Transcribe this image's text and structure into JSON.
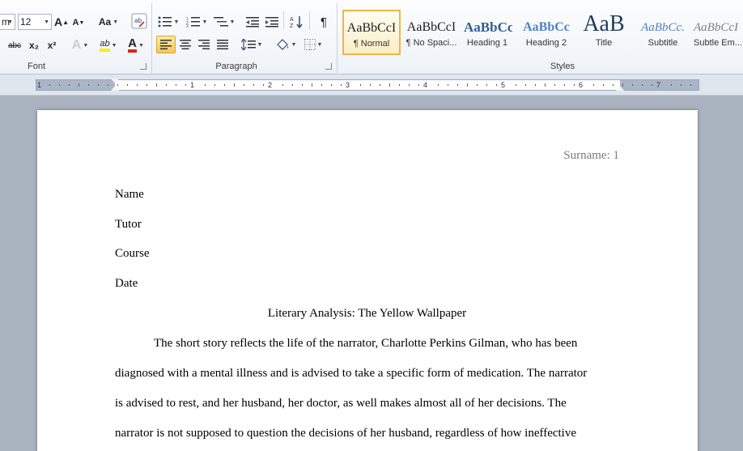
{
  "ribbon": {
    "font": {
      "font_name_fragment": "m",
      "font_size": "12",
      "group_label": "Font",
      "grow_font_icon": "A",
      "shrink_font_icon": "A",
      "change_case_label": "Aa",
      "clear_format_icon": "abc",
      "strikethrough_label": "abc",
      "subscript_label": "x₂",
      "superscript_label": "x²",
      "text_effects_label": "A",
      "highlight_label": "ab",
      "font_color_label": "A"
    },
    "paragraph": {
      "group_label": "Paragraph",
      "pilcrow": "¶"
    },
    "styles": {
      "group_label": "Styles",
      "items": [
        {
          "preview": "AaBbCcI",
          "name": "¶ Normal"
        },
        {
          "preview": "AaBbCcI",
          "name": "¶ No Spaci..."
        },
        {
          "preview": "AaBbCc",
          "name": "Heading 1"
        },
        {
          "preview": "AaBbCc",
          "name": "Heading 2"
        },
        {
          "preview": "AaB",
          "name": "Title"
        },
        {
          "preview": "AaBbCc.",
          "name": "Subtitle"
        },
        {
          "preview": "AaBbCcI",
          "name": "Subtle Em..."
        }
      ]
    }
  },
  "ruler": {
    "labels": [
      "1",
      "1",
      "2",
      "3",
      "4",
      "5",
      "6",
      "7"
    ]
  },
  "document": {
    "header": "Surname: 1",
    "name": "Name",
    "tutor": "Tutor",
    "course": "Course",
    "date": "Date",
    "title": "Literary Analysis: The Yellow Wallpaper",
    "body_lines": [
      "The short story reflects the life of the narrator, Charlotte Perkins Gilman, who has been",
      "diagnosed with a mental illness and is advised to take a specific form of medication. The narrator",
      "is advised to rest, and her husband, her doctor, as well makes almost all of her decisions. The",
      "narrator is not supposed to question the decisions of her husband, regardless of how ineffective"
    ]
  },
  "colors": {
    "accent_selected": "#f6c659",
    "highlight_yellow": "#ffee00",
    "font_color_red": "#d7261e",
    "heading_blue": "#2f5f93",
    "header_gray": "#7a7a7a"
  }
}
